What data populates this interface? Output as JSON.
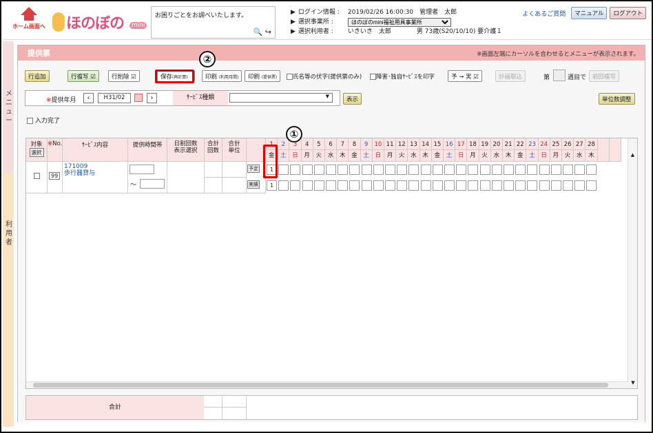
{
  "header": {
    "home_label": "ホーム画面へ",
    "logo_text": "ほのぼの",
    "logo_badge": "mini",
    "help_text": "お困りごとをお調べいたします。",
    "login_label": "ログイン情報 :",
    "login_value": "2019/02/26 16:00:30　管理者　太郎",
    "office_label": "選択事業所 :",
    "office_value": "ほのぼのmini福祉用具事業所",
    "user_label": "選択利用者 :",
    "user_value": "いきいき　太郎",
    "user_detail": "男 73歳(S20/10/10) 要介護１",
    "faq": "よくあるご質問",
    "manual": "マニュアル",
    "logout": "ログアウト"
  },
  "sidebar": {
    "menu": "メニュー",
    "user": "利用者"
  },
  "panel": {
    "title": "提供票",
    "note": "※画面左端にカーソルを合わせるとメニューが表示されます。"
  },
  "toolbar": {
    "add_row": "行追加",
    "copy_row": "行複写",
    "delete_row": "行削除",
    "save": "保存",
    "save_sub": "(再計算)",
    "print1": "印刷",
    "print1_sub": "(利用月間)",
    "print2": "印刷",
    "print2_sub": "(提供票)",
    "opt1": "氏名等の伏字(提供票のみ)",
    "opt2": "障害･独自ｻｰﾋﾞｽを印字",
    "plan_to_actual": "予 → 実",
    "plan_fetch": "計画取込",
    "week_label": "第",
    "week_suffix": "週目で",
    "prev_copy": "前回複写"
  },
  "filter": {
    "year_label": "提供年月",
    "year_value": "H31/02",
    "service_label": "ｻｰﾋﾞｽ種類",
    "display_btn": "表示",
    "unit_adjust": "単位数調整"
  },
  "input_done": "入力完了",
  "columns": {
    "target": "対象",
    "select": "選択",
    "no": "No.",
    "service": "ｻｰﾋﾞｽ内容",
    "time": "提供時間帯",
    "daily": "日割回数",
    "daily2": "表示選択",
    "total_count": "合計",
    "total_count2": "回数",
    "total_unit": "合計",
    "total_unit2": "単位"
  },
  "days": [
    "1",
    "2",
    "3",
    "4",
    "5",
    "6",
    "7",
    "8",
    "9",
    "10",
    "11",
    "12",
    "13",
    "14",
    "15",
    "16",
    "17",
    "18",
    "19",
    "20",
    "21",
    "22",
    "23",
    "24",
    "25",
    "26",
    "27",
    "28"
  ],
  "weekdays": [
    "金",
    "土",
    "日",
    "月",
    "火",
    "水",
    "木",
    "金",
    "土",
    "日",
    "月",
    "火",
    "水",
    "木",
    "金",
    "土",
    "日",
    "月",
    "火",
    "水",
    "木",
    "金",
    "土",
    "日",
    "月",
    "火",
    "水",
    "木"
  ],
  "row": {
    "no": "99",
    "code": "171009",
    "name": "歩行器貸与",
    "tilde": "～",
    "plan": "予定",
    "actual": "実績",
    "plan_day1": "1",
    "actual_day1": "1"
  },
  "footer": {
    "total": "合計"
  },
  "callouts": [
    "①",
    "②"
  ]
}
